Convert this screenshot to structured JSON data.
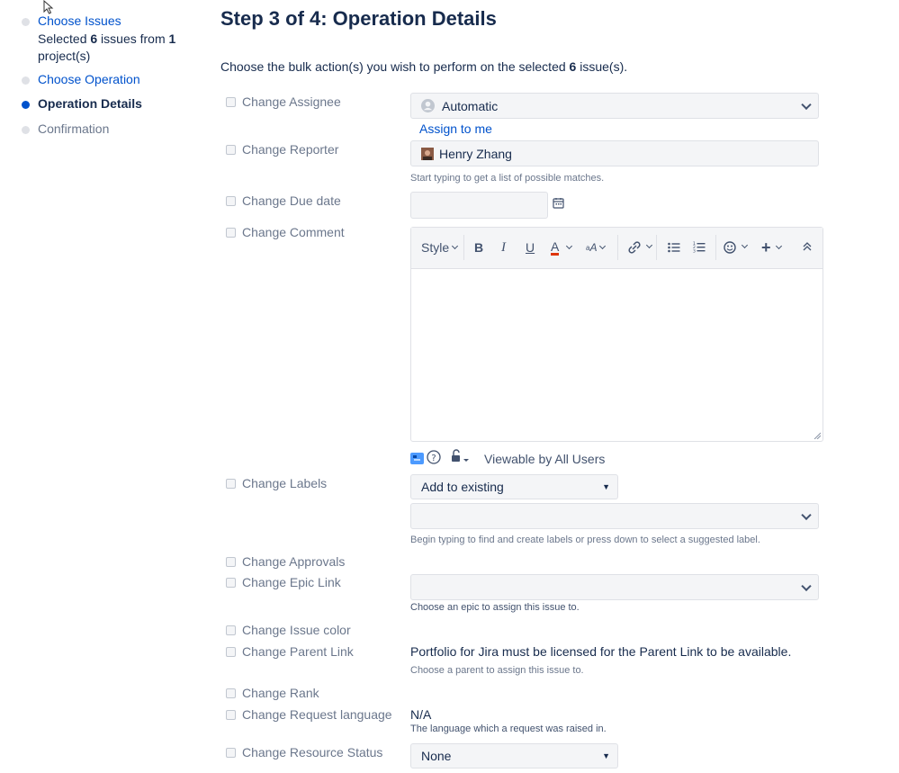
{
  "sidebar": {
    "steps": [
      {
        "label": "Choose Issues",
        "state": "done"
      },
      {
        "label": "Choose Operation",
        "state": "done"
      },
      {
        "label": "Operation Details",
        "state": "active"
      },
      {
        "label": "Confirmation",
        "state": "pending"
      }
    ],
    "selection": {
      "prefix": "Selected ",
      "count": "6",
      "middle": " issues from ",
      "projects": "1",
      "suffix": "project(s)"
    }
  },
  "main": {
    "title": "Step 3 of 4: Operation Details",
    "intro_prefix": "Choose the bulk action(s) you wish to perform on the selected ",
    "intro_count": "6",
    "intro_suffix": " issue(s)."
  },
  "rows": {
    "assignee": {
      "label": "Change Assignee",
      "value": "Automatic",
      "assign_to_me": "Assign to me"
    },
    "reporter": {
      "label": "Change Reporter",
      "value": "Henry Zhang",
      "help": "Start typing to get a list of possible matches."
    },
    "due_date": {
      "label": "Change Due date",
      "value": ""
    },
    "comment": {
      "label": "Change Comment",
      "style_label": "Style",
      "visibility": "Viewable by All Users"
    },
    "labels": {
      "label": "Change Labels",
      "mode": "Add to existing",
      "value": "",
      "help": "Begin typing to find and create labels or press down to select a suggested label."
    },
    "approvals": {
      "label": "Change Approvals"
    },
    "epic_link": {
      "label": "Change Epic Link",
      "value": "",
      "help": "Choose an epic to assign this issue to."
    },
    "issue_color": {
      "label": "Change Issue color"
    },
    "parent_link": {
      "label": "Change Parent Link",
      "message": "Portfolio for Jira must be licensed for the Parent Link to be available.",
      "help": "Choose a parent to assign this issue to."
    },
    "rank": {
      "label": "Change Rank"
    },
    "request_language": {
      "label": "Change Request language",
      "value": "N/A",
      "help": "The language which a request was raised in."
    },
    "resource_status": {
      "label": "Change Resource Status",
      "value": "None"
    }
  },
  "colors": {
    "link": "#0052cc",
    "active_dot": "#0052cc",
    "text": "#172b4d",
    "muted": "#6b778c",
    "field_bg": "#f4f5f7",
    "text_color_red": "#de350b"
  },
  "icons": [
    "cursor-icon",
    "user-avatar-icon",
    "calendar-icon",
    "bold-icon",
    "italic-icon",
    "underline-icon",
    "text-color-icon",
    "text-effects-icon",
    "link-icon",
    "bullet-list-icon",
    "numbered-list-icon",
    "emoji-icon",
    "insert-plus-icon",
    "collapse-toolbar-icon",
    "attachment-icon",
    "help-icon",
    "lock-icon"
  ]
}
